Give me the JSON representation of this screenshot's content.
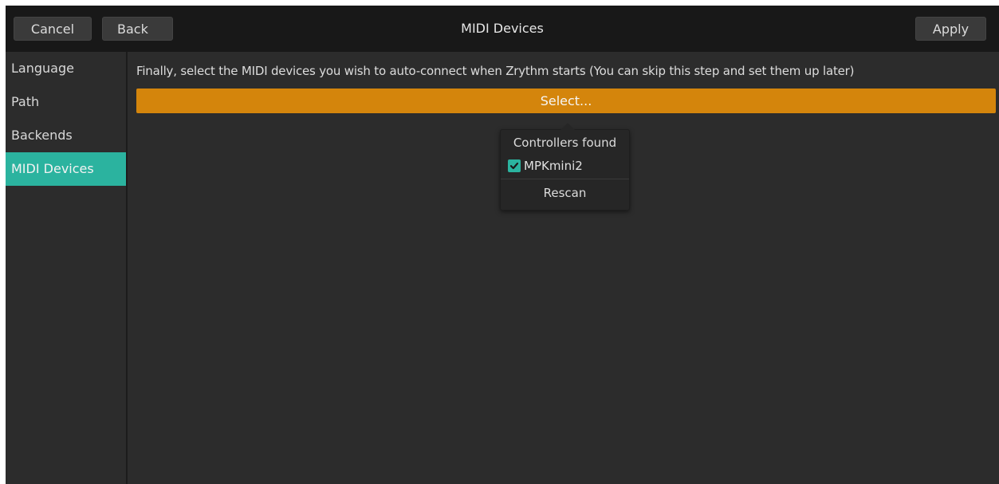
{
  "header": {
    "cancel_label": "Cancel",
    "back_label": "Back",
    "title": "MIDI Devices",
    "apply_label": "Apply"
  },
  "sidebar": {
    "items": [
      {
        "label": "Language",
        "active": false
      },
      {
        "label": "Path",
        "active": false
      },
      {
        "label": "Backends",
        "active": false
      },
      {
        "label": "MIDI Devices",
        "active": true
      }
    ]
  },
  "main": {
    "instructions": "Finally, select the MIDI devices you wish to auto-connect when Zrythm starts (You can skip this step and set them up later)",
    "select_label": "Select..."
  },
  "popover": {
    "title": "Controllers found",
    "devices": [
      {
        "label": "MPKmini2",
        "checked": true
      }
    ],
    "rescan_label": "Rescan"
  },
  "colors": {
    "accent": "#2bb39f",
    "select_button": "#d4850c",
    "headerbar": "#181818",
    "background": "#2c2c2c"
  },
  "icons": {
    "checkbox": "check-icon"
  }
}
